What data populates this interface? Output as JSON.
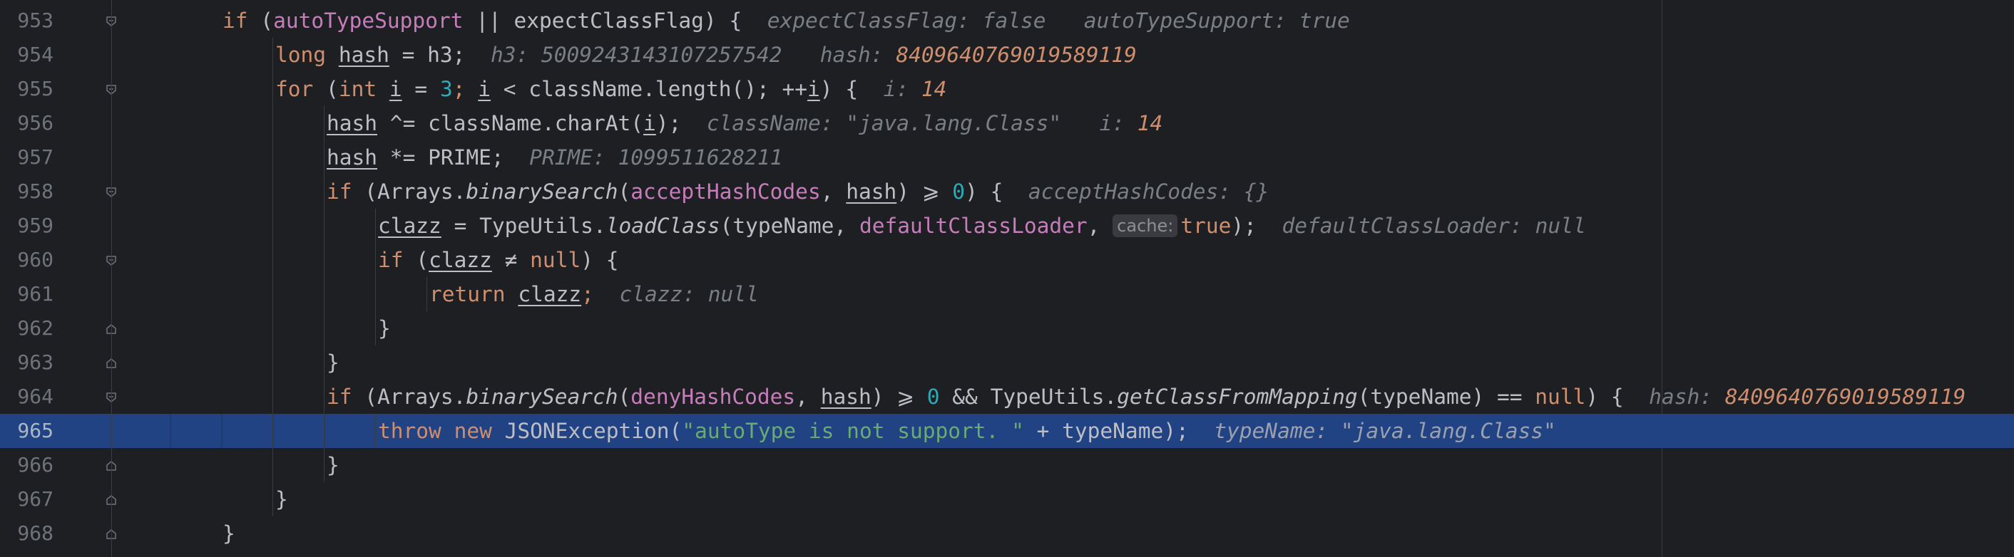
{
  "editor": {
    "lines": [
      {
        "num": "953",
        "t": {
          "a": "if",
          "b": "(",
          "c": "autoTypeSupport",
          "d": " || expectClassFlag) {",
          "h1": "expectClassFlag: false",
          "h2": "autoTypeSupport: true"
        }
      },
      {
        "num": "954",
        "t": {
          "a": "long",
          "b": "hash",
          "c": " = h3;",
          "h1": "h3: 5009243143107257542",
          "h2k": "hash: ",
          "h2v": "8409640769019589119"
        }
      },
      {
        "num": "955",
        "t": {
          "a": "for",
          "b": " (",
          "c": "int",
          "d": "i",
          "e": " = ",
          "f": "3",
          "g": ";",
          "h": "i",
          "i": " < className.length(); ++",
          "j": "i",
          "k": ") {",
          "h1k": "i: ",
          "h1v": "14"
        }
      },
      {
        "num": "956",
        "t": {
          "a": "hash",
          "b": " ^= className.charAt(",
          "c": "i",
          "d": ");",
          "h1": "className: \"java.lang.Class\"",
          "h2k": "i: ",
          "h2v": "14"
        }
      },
      {
        "num": "957",
        "t": {
          "a": "hash",
          "b": " *= PRIME;",
          "h1": "PRIME: 1099511628211"
        }
      },
      {
        "num": "958",
        "t": {
          "a": "if",
          "b": " (Arrays.",
          "c": "binarySearch",
          "d": "(",
          "e": "acceptHashCodes",
          "f": ", ",
          "g": "hash",
          "h": ") ⩾ ",
          "i": "0",
          "j": ") {",
          "h1": "acceptHashCodes: {}"
        }
      },
      {
        "num": "959",
        "t": {
          "a": "clazz",
          "b": " = TypeUtils.",
          "c": "loadClass",
          "d": "(typeName, ",
          "e": "defaultClassLoader",
          "f": ", ",
          "p": "cache:",
          "g": "true",
          "h": ");",
          "h1": "defaultClassLoader: null"
        }
      },
      {
        "num": "960",
        "t": {
          "a": "if",
          "b": " (",
          "c": "clazz",
          "d": " ≠ ",
          "e": "null",
          "f": ") {"
        }
      },
      {
        "num": "961",
        "t": {
          "a": "return",
          "b": "clazz",
          "c": ";",
          "h1": "clazz: null"
        }
      },
      {
        "num": "962",
        "t": {
          "a": "}"
        }
      },
      {
        "num": "963",
        "t": {
          "a": "}"
        }
      },
      {
        "num": "964",
        "t": {
          "a": "if",
          "b": " (Arrays.",
          "c": "binarySearch",
          "d": "(",
          "e": "denyHashCodes",
          "f": ", ",
          "g": "hash",
          "h": ") ⩾ ",
          "i": "0",
          "j": " && TypeUtils.",
          "k": "getClassFromMapping",
          "l": "(typeName) == ",
          "m": "null",
          "n": ") {",
          "h1k": "hash: ",
          "h1v": "8409640769019589119"
        }
      },
      {
        "num": "965",
        "t": {
          "a": "throw",
          "b": "new",
          "c": " JSONException(",
          "d": "\"autoType is not support. \"",
          "e": " + typeName);",
          "h1": "typeName: \"java.lang.Class\""
        }
      },
      {
        "num": "966",
        "t": {
          "a": "}"
        }
      },
      {
        "num": "967",
        "t": {
          "a": "}"
        }
      },
      {
        "num": "968",
        "t": {
          "a": "}"
        }
      }
    ]
  },
  "colors": {
    "background": "#1e1f22",
    "current_line": "#214283",
    "keyword": "#cf8e6d",
    "field": "#c77dbb",
    "number": "#2aacb8",
    "string": "#6aab73",
    "hint": "#7a7e85"
  }
}
